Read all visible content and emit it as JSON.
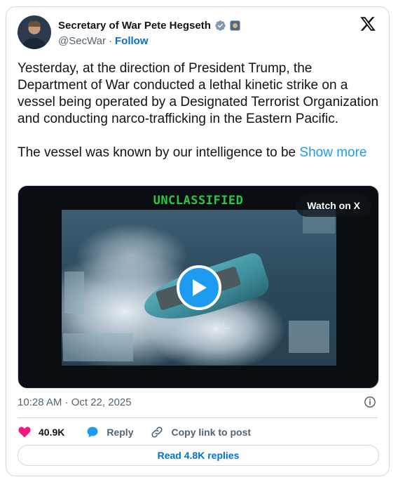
{
  "author": {
    "display_name": "Secretary of War Pete Hegseth",
    "handle": "@SecWar",
    "separator": "·",
    "follow_label": "Follow"
  },
  "tweet": {
    "paragraph_1": "Yesterday, at the direction of President Trump, the Department of War conducted a lethal kinetic strike on a vessel being operated by a Designated Terrorist Organization and conducting narco-trafficking in the Eastern Pacific.",
    "paragraph_2": "The vessel was known by our intelligence to be",
    "show_more_label": "Show more"
  },
  "media": {
    "overlay_text": "UNCLASSIFIED",
    "watch_label": "Watch on X"
  },
  "timestamp": "10:28 AM · Oct 22, 2025",
  "actions": {
    "likes_count": "40.9K",
    "reply_label": "Reply",
    "copy_link_label": "Copy link to post"
  },
  "read_replies_label": "Read 4.8K replies",
  "colors": {
    "accent": "#1d9bf0",
    "link": "#006fd6",
    "like": "#f91880",
    "overlay_green": "#29c742"
  },
  "icons": [
    "verified-badge-icon",
    "affiliate-badge-icon",
    "x-logo-icon",
    "play-icon",
    "crosshair-icon",
    "info-icon",
    "heart-icon",
    "reply-bubble-icon",
    "link-icon"
  ]
}
